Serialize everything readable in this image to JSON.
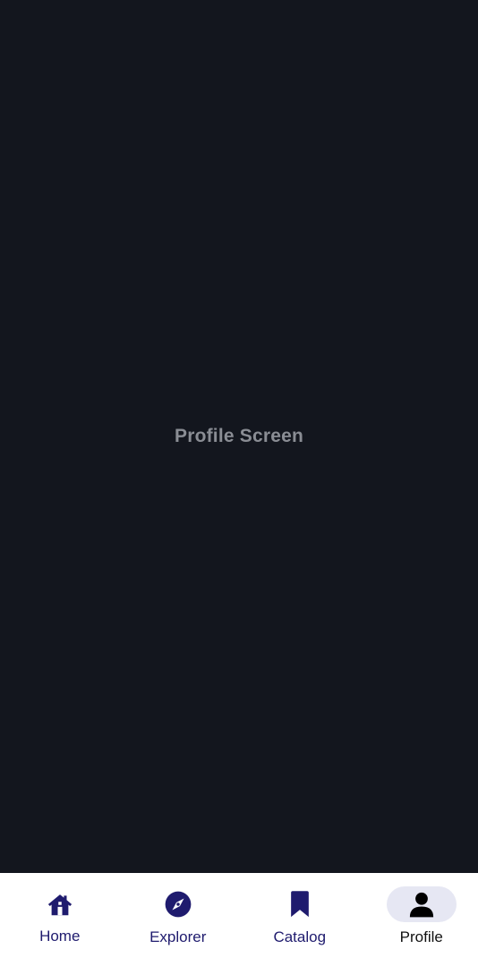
{
  "screen": {
    "title": "Profile Screen"
  },
  "bottom_nav": {
    "items": [
      {
        "id": "home",
        "label": "Home",
        "icon": "home-icon",
        "active": false
      },
      {
        "id": "explorer",
        "label": "Explorer",
        "icon": "compass-icon",
        "active": false
      },
      {
        "id": "catalog",
        "label": "Catalog",
        "icon": "bookmark-icon",
        "active": false
      },
      {
        "id": "profile",
        "label": "Profile",
        "icon": "person-icon",
        "active": true
      }
    ]
  },
  "colors": {
    "background": "#13161e",
    "title_text": "#8a8d94",
    "nav_background": "#ffffff",
    "nav_icon": "#1f1b6e",
    "active_indicator": "#e6e7f3",
    "active_icon": "#000000"
  }
}
